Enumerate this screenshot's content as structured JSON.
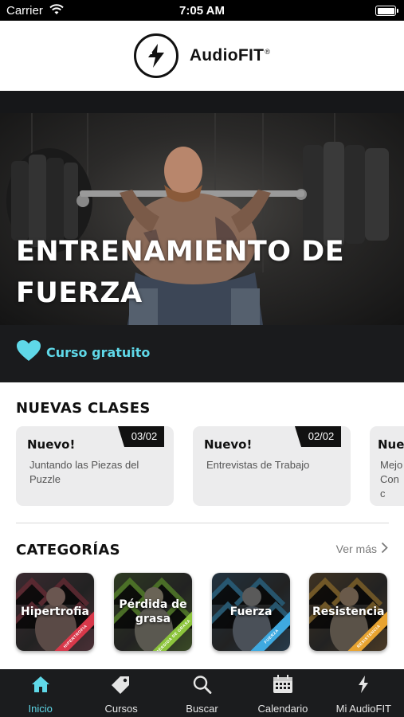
{
  "status_bar": {
    "carrier": "Carrier",
    "time": "7:05 AM"
  },
  "header": {
    "logo_text": "AudioFIT",
    "logo_mark": "®"
  },
  "hero": {
    "title": "ENTRENAMIENTO DE FUERZA",
    "badge_label": "Curso gratuito",
    "badge_icon": "heart-icon",
    "accent_color": "#5fd8e8"
  },
  "new_classes": {
    "title": "NUEVAS CLASES",
    "cards": [
      {
        "badge": "Nuevo!",
        "date": "03/02",
        "desc": "Juntando las Piezas del Puzzle"
      },
      {
        "badge": "Nuevo!",
        "date": "02/02",
        "desc": "Entrevistas de Trabajo"
      },
      {
        "badge": "Nue",
        "date": "",
        "desc": "Mejo Conc"
      }
    ]
  },
  "categories": {
    "title": "CATEGORÍAS",
    "see_more": "Ver más",
    "items": [
      {
        "name": "Hipertrofia",
        "ribbon": "HIPERTROFIA",
        "ribbon_color": "#d8384a"
      },
      {
        "name": "Pérdida de grasa",
        "ribbon": "PÉRDIDA DE GRASA",
        "ribbon_color": "#8cc43c"
      },
      {
        "name": "Fuerza",
        "ribbon": "FUERZA",
        "ribbon_color": "#3fa9e0"
      },
      {
        "name": "Resistencia",
        "ribbon": "RESISTENCIA",
        "ribbon_color": "#e8a330"
      }
    ]
  },
  "tab_bar": {
    "tabs": [
      {
        "label": "Inicio",
        "icon": "home-icon"
      },
      {
        "label": "Cursos",
        "icon": "tag-icon"
      },
      {
        "label": "Buscar",
        "icon": "search-icon"
      },
      {
        "label": "Calendario",
        "icon": "calendar-icon"
      },
      {
        "label": "Mi AudioFIT",
        "icon": "bolt-icon"
      }
    ],
    "active_color": "#5fd8e8"
  }
}
